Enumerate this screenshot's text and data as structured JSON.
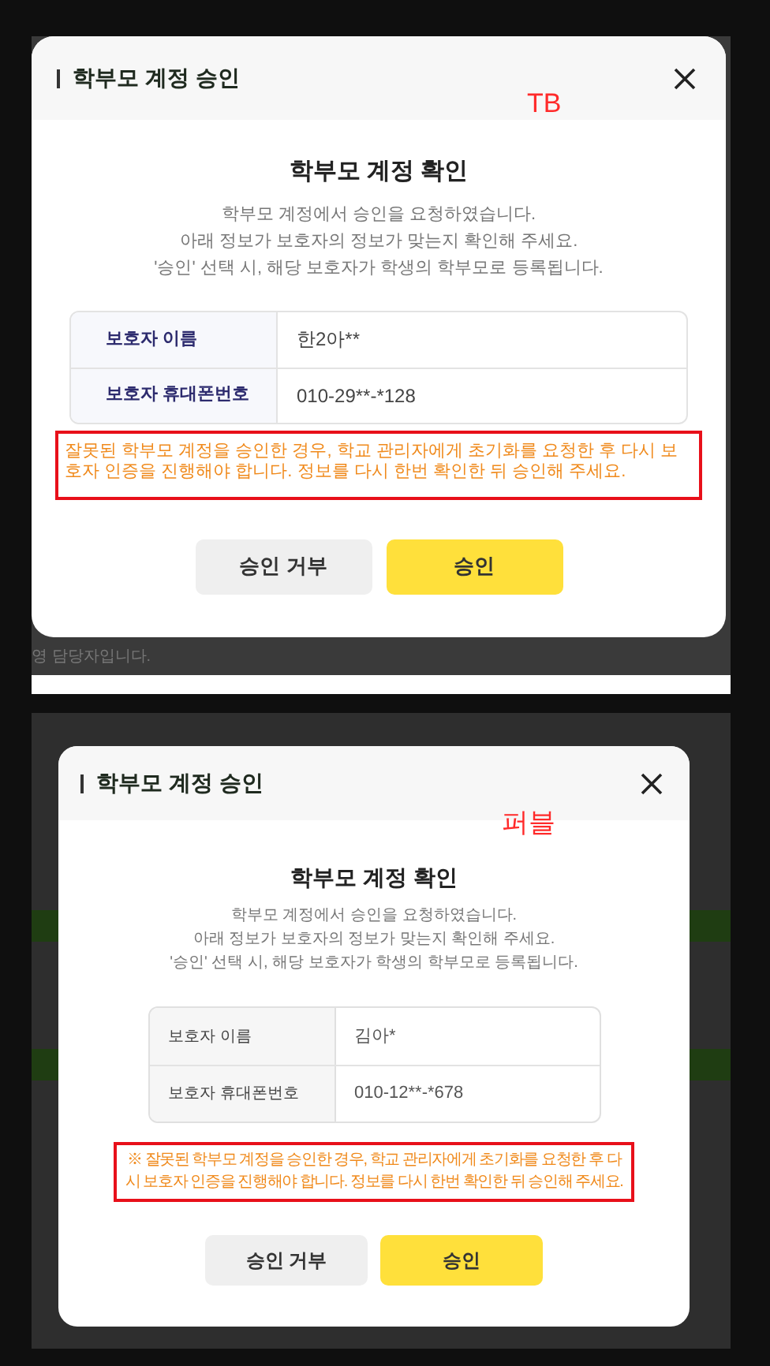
{
  "dialogs": [
    {
      "kind": "tb",
      "title": "학부모 계정 승인",
      "annotation": "TB",
      "heading": "학부모 계정 확인",
      "description": [
        "학부모 계정에서 승인을 요청하였습니다.",
        "아래 정보가 보호자의 정보가 맞는지 확인해 주세요.",
        "'승인' 선택 시, 해당 보호자가 학생의 학부모로 등록됩니다."
      ],
      "fields": [
        {
          "label": "보호자 이름",
          "value": "한2아**"
        },
        {
          "label": "보호자 휴대폰번호",
          "value": "010-29**-*128"
        }
      ],
      "warning": "잘못된 학부모 계정을 승인한 경우, 학교 관리자에게 초기화를 요청한 후 다시 보호자 인증을 진행해야 합니다. 정보를 다시 한번 확인한 뒤 승인해 주세요.",
      "buttons": [
        {
          "label": "승인 거부",
          "kind": "secondary"
        },
        {
          "label": "승인",
          "kind": "primary"
        }
      ],
      "footer_text": "영 담당자입니다."
    },
    {
      "kind": "pubble",
      "title": "학부모 계정 승인",
      "annotation": "퍼블",
      "heading": "학부모 계정 확인",
      "description": [
        "학부모 계정에서 승인을 요청하였습니다.",
        "아래 정보가 보호자의 정보가 맞는지 확인해 주세요.",
        "'승인' 선택 시, 해당 보호자가 학생의 학부모로 등록됩니다."
      ],
      "fields": [
        {
          "label": "보호자 이름",
          "value": "김아*"
        },
        {
          "label": "보호자 휴대폰번호",
          "value": "010-12**-*678"
        }
      ],
      "warning": "※ 잘못된 학부모 계정을 승인한 경우, 학교 관리자에게 초기화를 요청한 후 다시 보호자 인증을 진행해야 합니다. 정보를 다시 한번 확인한 뒤 승인해 주세요.",
      "buttons": [
        {
          "label": "승인 거부",
          "kind": "secondary"
        },
        {
          "label": "승인",
          "kind": "primary"
        }
      ]
    }
  ]
}
